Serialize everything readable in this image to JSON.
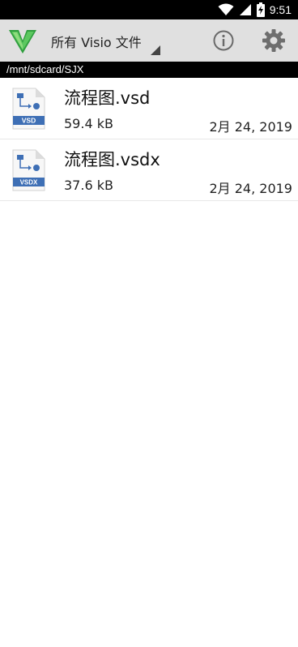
{
  "status_bar": {
    "time": "9:51",
    "icons": [
      "wifi-icon",
      "signal-icon",
      "battery-charging-icon"
    ]
  },
  "app_bar": {
    "title": "所有 Visio 文件",
    "icons": [
      "app-logo",
      "info-icon",
      "gear-icon"
    ],
    "logo_color": "#3cb54a"
  },
  "path": "/mnt/sdcard/SJX",
  "files": [
    {
      "name": "流程图.vsd",
      "size": "59.4 kB",
      "date": "2月 24, 2019",
      "badge": "VSD"
    },
    {
      "name": "流程图.vsdx",
      "size": "37.6 kB",
      "date": "2月 24, 2019",
      "badge": "VSDX"
    }
  ],
  "colors": {
    "status_bar": "#000000",
    "app_bar": "#e0e0e0",
    "path_bar": "#000000",
    "file_icon_blue": "#3e6fb5"
  }
}
